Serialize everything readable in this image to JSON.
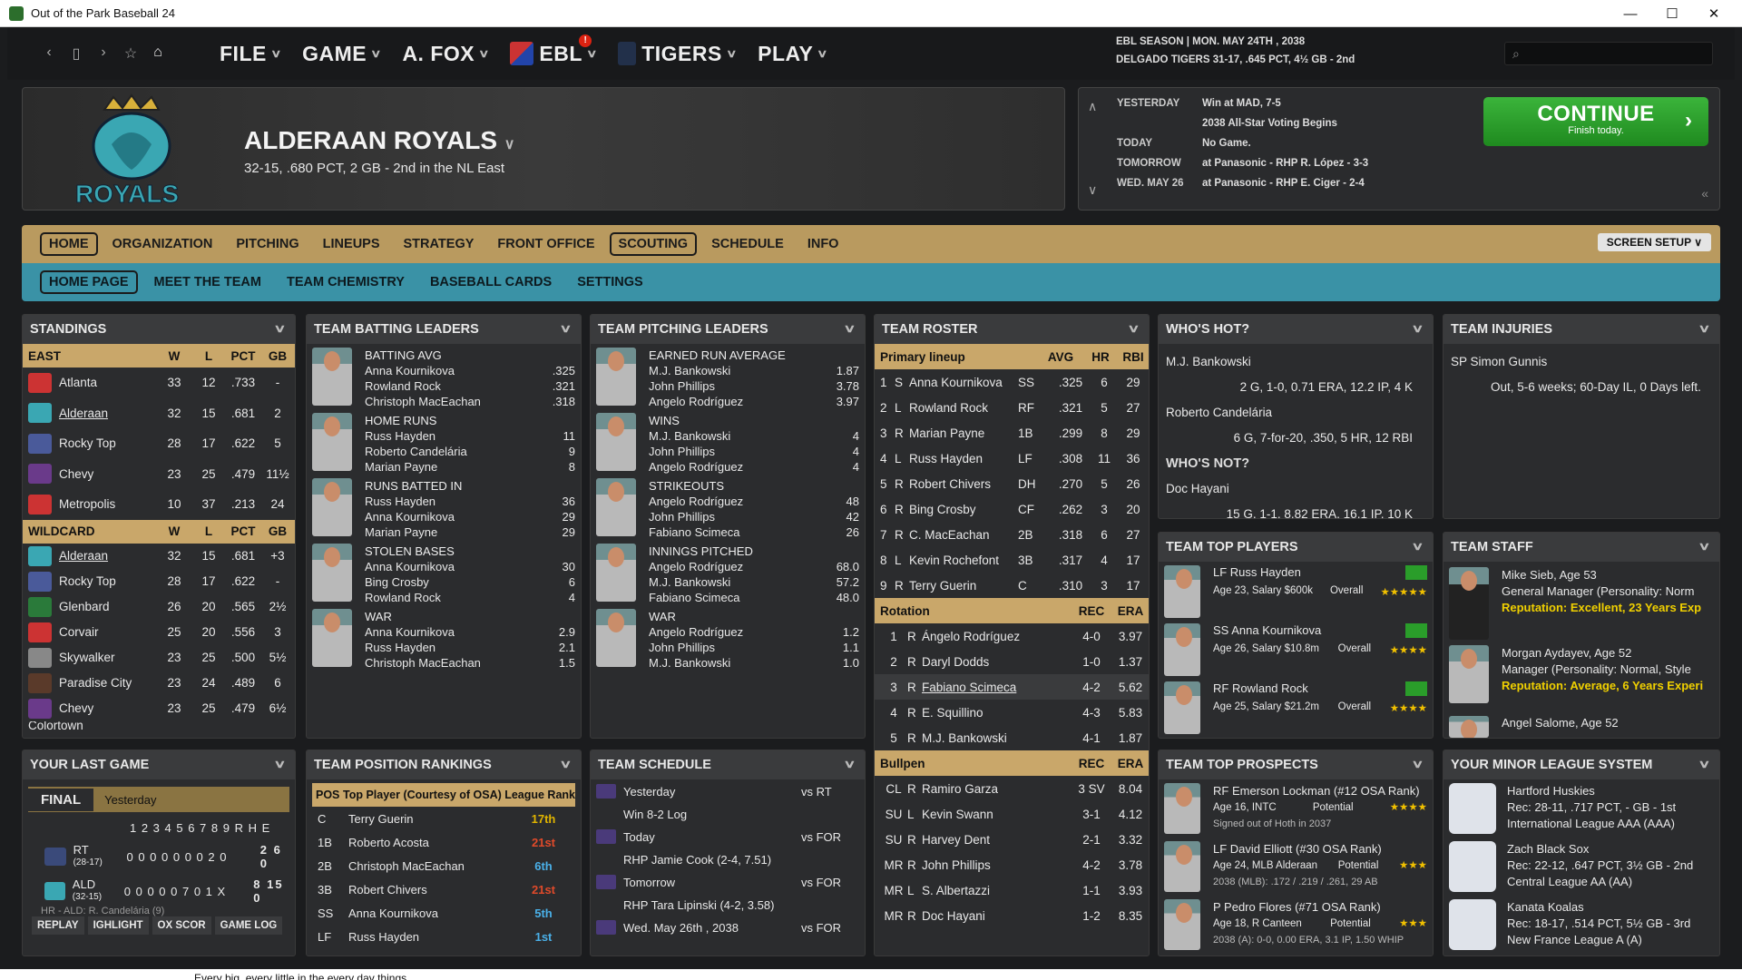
{
  "window": {
    "title": "Out of the Park Baseball 24"
  },
  "menu": {
    "file": "FILE",
    "game": "GAME",
    "manager": "A. FOX",
    "league": "EBL",
    "team": "TIGERS",
    "play": "PLAY"
  },
  "season": {
    "line1": "EBL SEASON  |  MON. MAY 24TH , 2038",
    "line2": "DELGADO TIGERS  31-17, .645 PCT, 4½ GB - 2nd"
  },
  "banner": {
    "team_name": "ALDERAAN ROYALS",
    "record": "32-15, .680 PCT, 2 GB - 2nd in the NL East",
    "logo_text": "ROYALS"
  },
  "schedule_box": {
    "rows": [
      {
        "k": "YESTERDAY",
        "v": "Win at MAD, 7-5"
      },
      {
        "k": "",
        "v": "2038 All-Star Voting Begins"
      },
      {
        "k": "TODAY",
        "v": "No Game."
      },
      {
        "k": "TOMORROW",
        "v": "at Panasonic - RHP R. López - 3-3"
      },
      {
        "k": "WED. MAY 26",
        "v": "at Panasonic - RHP E. Ciger - 2-4"
      }
    ],
    "continue_label": "CONTINUE",
    "continue_sub": "Finish today."
  },
  "tabs": {
    "home": "HOME",
    "organization": "ORGANIZATION",
    "pitching": "PITCHING",
    "lineups": "LINEUPS",
    "strategy": "STRATEGY",
    "front_office": "FRONT OFFICE",
    "scouting": "SCOUTING",
    "schedule": "SCHEDULE",
    "info": "INFO",
    "screen_setup": "SCREEN SETUP"
  },
  "subtabs": {
    "home_page": "HOME PAGE",
    "meet_team": "MEET THE TEAM",
    "chemistry": "TEAM CHEMISTRY",
    "cards": "BASEBALL CARDS",
    "settings": "SETTINGS"
  },
  "standings": {
    "title": "STANDINGS",
    "east_header": [
      "EAST",
      "W",
      "L",
      "PCT",
      "GB"
    ],
    "east": [
      [
        "Atlanta",
        "33",
        "12",
        ".733",
        "-"
      ],
      [
        "Alderaan",
        "32",
        "15",
        ".681",
        "2"
      ],
      [
        "Rocky Top",
        "28",
        "17",
        ".622",
        "5"
      ],
      [
        "Chevy",
        "23",
        "25",
        ".479",
        "11½"
      ],
      [
        "Metropolis",
        "10",
        "37",
        ".213",
        "24"
      ]
    ],
    "wc_header": [
      "WILDCARD",
      "W",
      "L",
      "PCT",
      "GB"
    ],
    "wc": [
      [
        "Alderaan",
        "32",
        "15",
        ".681",
        "+3"
      ],
      [
        "Rocky Top",
        "28",
        "17",
        ".622",
        "-"
      ],
      [
        "Glenbard",
        "26",
        "20",
        ".565",
        "2½"
      ],
      [
        "Corvair",
        "25",
        "20",
        ".556",
        "3"
      ],
      [
        "Skywalker",
        "23",
        "25",
        ".500",
        "5½"
      ],
      [
        "Paradise City",
        "23",
        "24",
        ".489",
        "6"
      ],
      [
        "Chevy",
        "23",
        "25",
        ".479",
        "6½"
      ]
    ],
    "partial": "Colortown"
  },
  "batting": {
    "title": "TEAM BATTING LEADERS",
    "groups": [
      {
        "cat": "BATTING AVG",
        "rows": [
          [
            "Anna Kournikova",
            ".325"
          ],
          [
            "Rowland Rock",
            ".321"
          ],
          [
            "Christoph MacEachan",
            ".318"
          ]
        ]
      },
      {
        "cat": "HOME RUNS",
        "rows": [
          [
            "Russ Hayden",
            "11"
          ],
          [
            "Roberto Candelária",
            "9"
          ],
          [
            "Marian Payne",
            "8"
          ]
        ]
      },
      {
        "cat": "RUNS BATTED IN",
        "rows": [
          [
            "Russ Hayden",
            "36"
          ],
          [
            "Anna Kournikova",
            "29"
          ],
          [
            "Marian Payne",
            "29"
          ]
        ]
      },
      {
        "cat": "STOLEN BASES",
        "rows": [
          [
            "Anna Kournikova",
            "30"
          ],
          [
            "Bing Crosby",
            "6"
          ],
          [
            "Rowland Rock",
            "4"
          ]
        ]
      },
      {
        "cat": "WAR",
        "rows": [
          [
            "Anna Kournikova",
            "2.9"
          ],
          [
            "Russ Hayden",
            "2.1"
          ],
          [
            "Christoph MacEachan",
            "1.5"
          ]
        ]
      }
    ]
  },
  "pitching": {
    "title": "TEAM PITCHING LEADERS",
    "groups": [
      {
        "cat": "EARNED RUN AVERAGE",
        "rows": [
          [
            "M.J. Bankowski",
            "1.87"
          ],
          [
            "John Phillips",
            "3.78"
          ],
          [
            "Angelo Rodríguez",
            "3.97"
          ]
        ]
      },
      {
        "cat": "WINS",
        "rows": [
          [
            "M.J. Bankowski",
            "4"
          ],
          [
            "John Phillips",
            "4"
          ],
          [
            "Angelo Rodríguez",
            "4"
          ]
        ]
      },
      {
        "cat": "STRIKEOUTS",
        "rows": [
          [
            "Angelo Rodríguez",
            "48"
          ],
          [
            "John Phillips",
            "42"
          ],
          [
            "Fabiano Scimeca",
            "26"
          ]
        ]
      },
      {
        "cat": "INNINGS PITCHED",
        "rows": [
          [
            "Angelo Rodríguez",
            "68.0"
          ],
          [
            "M.J. Bankowski",
            "57.2"
          ],
          [
            "Fabiano Scimeca",
            "48.0"
          ]
        ]
      },
      {
        "cat": "WAR",
        "rows": [
          [
            "Angelo Rodríguez",
            "1.2"
          ],
          [
            "John Phillips",
            "1.1"
          ],
          [
            "M.J. Bankowski",
            "1.0"
          ]
        ]
      }
    ]
  },
  "roster": {
    "title": "TEAM ROSTER",
    "lineup_header": [
      "Primary lineup",
      "AVG",
      "HR",
      "RBI"
    ],
    "lineup": [
      [
        "1",
        "S",
        "Anna Kournikova",
        "SS",
        ".325",
        "6",
        "29"
      ],
      [
        "2",
        "L",
        "Rowland Rock",
        "RF",
        ".321",
        "5",
        "27"
      ],
      [
        "3",
        "R",
        "Marian Payne",
        "1B",
        ".299",
        "8",
        "29"
      ],
      [
        "4",
        "L",
        "Russ Hayden",
        "LF",
        ".308",
        "11",
        "36"
      ],
      [
        "5",
        "R",
        "Robert Chivers",
        "DH",
        ".270",
        "5",
        "26"
      ],
      [
        "6",
        "R",
        "Bing Crosby",
        "CF",
        ".262",
        "3",
        "20"
      ],
      [
        "7",
        "R",
        "C. MacEachan",
        "2B",
        ".318",
        "6",
        "27"
      ],
      [
        "8",
        "L",
        "Kevin Rochefont",
        "3B",
        ".317",
        "4",
        "17"
      ],
      [
        "9",
        "R",
        "Terry Guerin",
        "C",
        ".310",
        "3",
        "17"
      ]
    ],
    "rot_header": [
      "Rotation",
      "REC",
      "ERA"
    ],
    "rotation": [
      [
        "1",
        "R",
        "Ángelo Rodríguez",
        "4-0",
        "3.97"
      ],
      [
        "2",
        "R",
        "Daryl Dodds",
        "1-0",
        "1.37"
      ],
      [
        "3",
        "R",
        "Fabiano Scimeca",
        "4-2",
        "5.62"
      ],
      [
        "4",
        "R",
        "E. Squillino",
        "4-3",
        "5.83"
      ],
      [
        "5",
        "R",
        "M.J. Bankowski",
        "4-1",
        "1.87"
      ]
    ],
    "bp_header": [
      "Bullpen",
      "REC",
      "ERA"
    ],
    "bullpen": [
      [
        "CL",
        "R",
        "Ramiro Garza",
        "3 SV",
        "8.04"
      ],
      [
        "SU",
        "L",
        "Kevin Swann",
        "3-1",
        "4.12"
      ],
      [
        "SU",
        "R",
        "Harvey Dent",
        "2-1",
        "3.32"
      ],
      [
        "MR",
        "R",
        "John Phillips",
        "4-2",
        "3.78"
      ],
      [
        "MR",
        "L",
        "S. Albertazzi",
        "1-1",
        "3.93"
      ],
      [
        "MR",
        "R",
        "Doc Hayani",
        "1-2",
        "8.35"
      ]
    ]
  },
  "hot": {
    "title": "WHO'S HOT?",
    "p1": "M.J. Bankowski",
    "s1": "2 G, 1-0, 0.71 ERA, 12.2 IP, 4 K",
    "p2": "Roberto Candelária",
    "s2": "6 G, 7-for-20, .350, 5 HR, 12 RBI",
    "not_title": "WHO'S NOT?",
    "p3": "Doc Hayani",
    "s3": "15 G, 1-1, 8.82 ERA, 16.1 IP, 10 K"
  },
  "injuries": {
    "title": "TEAM INJURIES",
    "name": "SP Simon Gunnis",
    "detail": "Out, 5-6 weeks; 60-Day IL, 0 Days left."
  },
  "top_players": {
    "title": "TEAM TOP PLAYERS",
    "players": [
      {
        "name": "LF Russ Hayden",
        "info": "Age 23, Salary $600k",
        "ov": "Overall",
        "stars": "★★★★★"
      },
      {
        "name": "SS Anna Kournikova",
        "info": "Age 26, Salary $10.8m",
        "ov": "Overall",
        "stars": "★★★★"
      },
      {
        "name": "RF Rowland Rock",
        "info": "Age 25, Salary $21.2m",
        "ov": "Overall",
        "stars": "★★★★"
      }
    ]
  },
  "staff": {
    "title": "TEAM STAFF",
    "s1_name": "Mike Sieb, Age 53",
    "s1_role": "General Manager (Personality: Norm",
    "s1_rep": "Reputation: Excellent, 23 Years Exp",
    "s2_name": "Morgan Aydayev, Age 52",
    "s2_role": "Manager (Personality: Normal, Style",
    "s2_rep": "Reputation: Average, 6 Years Experi",
    "s3_name": "Angel Salome, Age 52"
  },
  "last_game": {
    "title": "YOUR LAST GAME",
    "final": "FINAL",
    "when": "Yesterday",
    "innings": "1 2 3 4 5 6 7 8 9   R H E",
    "away": "RT",
    "away_rec": "(28-17)",
    "away_line": "0 0 0 0 0 0 0 2 0",
    "away_rhe": "2 6 0",
    "home": "ALD",
    "home_rec": "(32-15)",
    "home_line": "0 0 0 0 0 7 0 1 X",
    "home_rhe": "8 15 0",
    "note": "HR - ALD: R. Candelária (9)",
    "btn_replay": "REPLAY",
    "btn_high": "IGHLIGHT",
    "btn_box": "OX SCOR",
    "btn_log": "GAME LOG"
  },
  "position": {
    "title": "TEAM POSITION RANKINGS",
    "header": [
      "POS",
      "Top Player (Courtesy of OSA)",
      "League Rank"
    ],
    "rows": [
      [
        "C",
        "Terry Guerin",
        "17th"
      ],
      [
        "1B",
        "Roberto Acosta",
        "21st"
      ],
      [
        "2B",
        "Christoph MacEachan",
        "6th"
      ],
      [
        "3B",
        "Robert Chivers",
        "21st"
      ],
      [
        "SS",
        "Anna Kournikova",
        "5th"
      ],
      [
        "LF",
        "Russ Hayden",
        "1st"
      ]
    ]
  },
  "team_schedule": {
    "title": "TEAM SCHEDULE",
    "rows": [
      {
        "day": "Yesterday",
        "opp": "vs RT",
        "sub": "Win 8-2        Log"
      },
      {
        "day": "Today",
        "opp": "vs FOR",
        "sub": "RHP Jamie Cook (2-4, 7.51)"
      },
      {
        "day": "Tomorrow",
        "opp": "vs FOR",
        "sub": "RHP Tara Lipinski (4-2, 3.58)"
      },
      {
        "day": "Wed. May 26th , 2038",
        "opp": "vs FOR",
        "sub": ""
      }
    ]
  },
  "prospects": {
    "title": "TEAM TOP PROSPECTS",
    "players": [
      {
        "name": "RF Emerson Lockman (#12 OSA Rank)",
        "info": "Age 16, INTC",
        "pot": "Potential",
        "stars": "★★★★",
        "extra": "Signed out of Hoth in 2037"
      },
      {
        "name": "LF David Elliott (#30 OSA Rank)",
        "info": "Age 24, MLB Alderaan",
        "pot": "Potential",
        "stars": "★★★",
        "extra": "2038 (MLB): .172 / .219 / .261, 29 AB"
      },
      {
        "name": "P Pedro Flores (#71 OSA Rank)",
        "info": "Age 18, R Canteen",
        "pot": "Potential",
        "stars": "★★★",
        "extra": "2038 (A): 0-0, 0.00 ERA, 3.1 IP, 1.50 WHIP"
      }
    ]
  },
  "minors": {
    "title": "YOUR MINOR LEAGUE SYSTEM",
    "teams": [
      {
        "name": "Hartford Huskies",
        "rec": "Rec: 28-11, .717 PCT, - GB - 1st",
        "lg": "International League AAA (AAA)"
      },
      {
        "name": "Zach Black Sox",
        "rec": "Rec: 22-12, .647 PCT, 3½ GB - 2nd",
        "lg": "Central League AA (AA)"
      },
      {
        "name": "Kanata Koalas",
        "rec": "Rec: 18-17, .514 PCT, 5½ GB - 3rd",
        "lg": "New France League A (A)"
      }
    ]
  },
  "footer": {
    "text": "Every big, every little in the every day things"
  },
  "colors": {
    "gold": "#c9a76a",
    "teal": "#3a92a6",
    "green": "#2a9d2a",
    "rank_gold": "#e0b400",
    "rank_red": "#e04a2a",
    "rank_blue": "#4ab0e8"
  }
}
